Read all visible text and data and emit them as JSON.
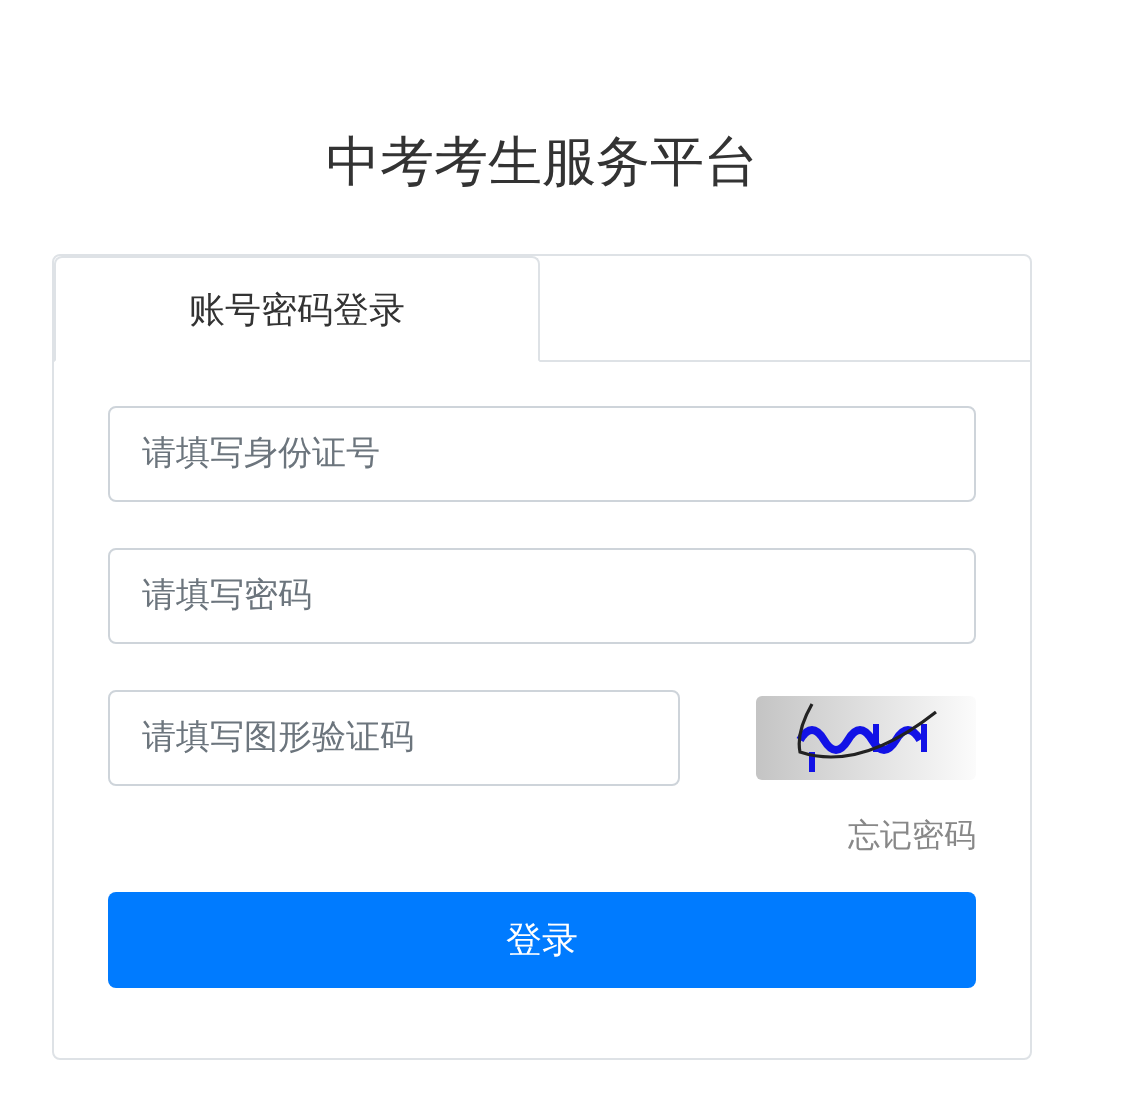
{
  "title": "中考考生服务平台",
  "tabs": [
    {
      "label": "账号密码登录",
      "selected": true
    }
  ],
  "fields": [
    {
      "placeholder": "请填写身份证号"
    },
    {
      "placeholder": "请填写密码"
    }
  ],
  "captcha": {
    "placeholder": "请填写图形验证码",
    "kind": "picture"
  },
  "forgot_link": "忘记密码",
  "login_button": "登录"
}
